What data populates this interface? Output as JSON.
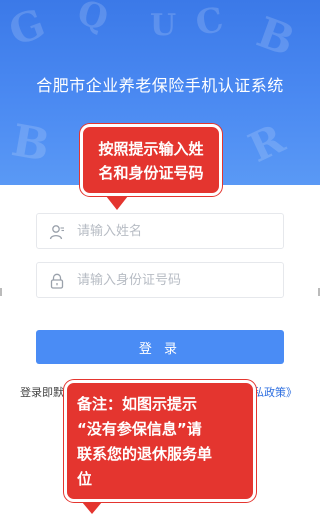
{
  "header": {
    "title": "合肥市企业养老保险手机认证系统"
  },
  "form": {
    "name_placeholder": "请输入姓名",
    "name_icon": "user-icon",
    "id_placeholder": "请输入身份证号码",
    "id_icon": "lock-icon",
    "login_label": "登 录"
  },
  "agreement": {
    "prefix": "登录即默",
    "link": "隐私政策》"
  },
  "annotations": {
    "tip_top": [
      "按照提示输入姓",
      "名和身份证号码"
    ],
    "tip_bottom": [
      "备注：如图示提示",
      "“没有参保信息”请",
      "联系您的退休服务单",
      "位"
    ]
  },
  "colors": {
    "header_blue": "#4b8af2",
    "button_blue": "#4a8cf5",
    "link_blue": "#2e6fe0",
    "annotation_red": "#e4352f"
  }
}
